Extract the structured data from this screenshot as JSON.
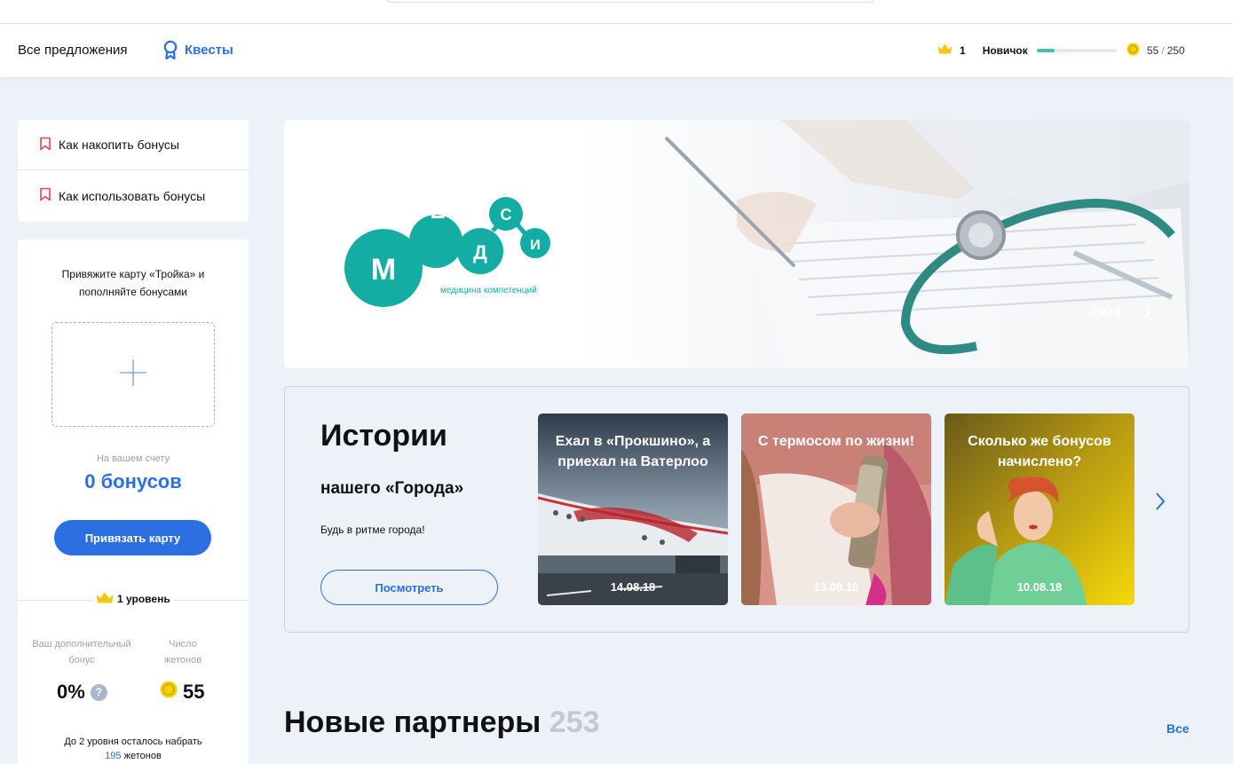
{
  "nav": {
    "all_offers": "Все предложения",
    "quests": "Квесты",
    "level_number": "1",
    "level_name": "Новичок",
    "level_progress": 0.22,
    "coins_current": "55",
    "coins_separator": "/",
    "coins_total": "250"
  },
  "howto": {
    "items": [
      {
        "label": "Как накопить бонусы"
      },
      {
        "label": "Как использовать бонусы"
      }
    ]
  },
  "card": {
    "prompt": "Привяжите карту «Тройка» и пополняйте бонусами",
    "account_label": "На вашем счету",
    "account_value": "0 бонусов",
    "bind_button": "Привязать карту",
    "level_badge": "1 уровень",
    "bonus_label": "Ваш дополнительный бонус",
    "bonus_value": "0%",
    "help_glyph": "?",
    "tokens_label": "Число жетонов",
    "tokens_value": "55",
    "remain_prefix": "До 2 уровня осталось набрать",
    "remain_amount": "195",
    "remain_suffix": "жетонов"
  },
  "banner": {
    "logo_letters": [
      "М",
      "Е",
      "Д",
      "С",
      "И"
    ],
    "logo_tagline": "медицина компетенций",
    "counter": "2 из 8"
  },
  "stories": {
    "title": "Истории",
    "subtitle": "нашего «Города»",
    "description": "Будь в ритме города!",
    "button": "Посмотреть",
    "items": [
      {
        "caption": "Ехал в «Прокшино», а приехал на Ватерлоо",
        "date": "14.08.18"
      },
      {
        "caption": "С термосом по жизни!",
        "date": "13.08.18"
      },
      {
        "caption": "Сколько же бонусов начислено?",
        "date": "10.08.18"
      }
    ]
  },
  "partners": {
    "title": "Новые партнеры",
    "count": "253",
    "all_link": "Все"
  },
  "colors": {
    "accent": "#2b6fe0",
    "progress": "#3ec5a0",
    "logo": "#13ada3",
    "coin": "#f5d100"
  }
}
